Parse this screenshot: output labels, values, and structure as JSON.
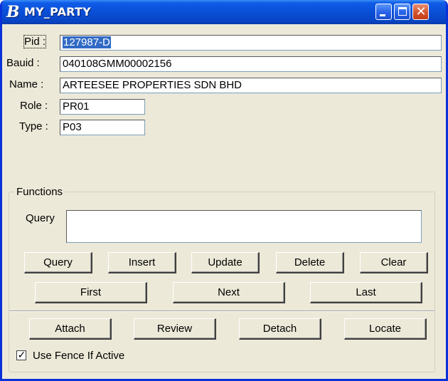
{
  "window": {
    "title": "MY_PARTY",
    "app_icon": "bentley-b-icon",
    "controls": {
      "minimize": "minimize-icon",
      "maximize": "maximize-icon",
      "close": "close-icon",
      "close_glyph": "✕"
    }
  },
  "fields": {
    "pid": {
      "label": "Pid :",
      "value": "127987-D"
    },
    "bauid": {
      "label": "Bauid :",
      "value": "040108GMM00002156"
    },
    "name": {
      "label": "Name :",
      "value": "ARTEESEE PROPERTIES SDN BHD"
    },
    "role": {
      "label": "Role :",
      "value": "PR01"
    },
    "type": {
      "label": "Type :",
      "value": "P03"
    }
  },
  "functions": {
    "group_label": "Functions",
    "query_label": "Query",
    "query_value": "",
    "buttons_row1": [
      "Query",
      "Insert",
      "Update",
      "Delete",
      "Clear"
    ],
    "buttons_row2": [
      "First",
      "Next",
      "Last"
    ],
    "buttons_row3": [
      "Attach",
      "Review",
      "Detach",
      "Locate"
    ]
  },
  "options": {
    "use_fence_label": "Use Fence If Active",
    "use_fence_checked": true,
    "check_glyph": "✓"
  }
}
